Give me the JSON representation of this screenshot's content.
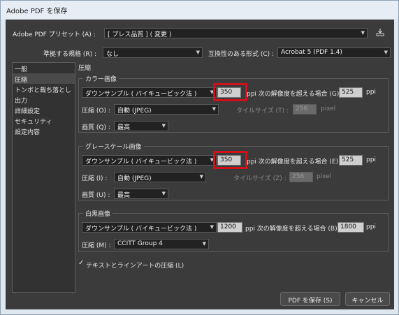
{
  "window": {
    "title": "Adobe PDF を保存"
  },
  "preset": {
    "label": "Adobe PDF プリセット (A) :",
    "value": "[ プレス品質 ] ( 変更 )"
  },
  "standard": {
    "label": "準拠する規格 (R) :",
    "value": "なし"
  },
  "compat": {
    "label": "互換性のある形式 (C) :",
    "value": "Acrobat 5 (PDF 1.4)"
  },
  "nav": {
    "items": [
      "一般",
      "圧縮",
      "トンボと裁ち落とし",
      "出力",
      "詳細設定",
      "セキュリティ",
      "設定内容"
    ]
  },
  "section_title": "圧縮",
  "color": {
    "title": "カラー画像",
    "downsample": "ダウンサンプル ( バイキュービック法 )",
    "ppi_value": "350",
    "threshold_label": "ppi 次の解像度を超える場合 (G)",
    "threshold_value": "525",
    "ppi_unit": "ppi",
    "compression_label": "圧縮 (O) :",
    "compression_value": "自動 (JPEG)",
    "tile_label": "タイルサイズ (T) :",
    "tile_value": "256",
    "tile_unit": "pixel",
    "quality_label": "画質 (Q) :",
    "quality_value": "最高"
  },
  "gray": {
    "title": "グレースケール画像",
    "downsample": "ダウンサンプル ( バイキュービック法 )",
    "ppi_value": "350",
    "threshold_label": "ppi 次の解像度を超える場合 (E)",
    "threshold_value": "525",
    "ppi_unit": "ppi",
    "compression_label": "圧縮 (I) :",
    "compression_value": "自動 (JPEG)",
    "tile_label": "タイルサイズ (Z) :",
    "tile_value": "256",
    "tile_unit": "pixel",
    "quality_label": "画質 (U) :",
    "quality_value": "最高"
  },
  "mono": {
    "title": "白黒画像",
    "downsample": "ダウンサンプル ( バイキュービック法 )",
    "ppi_value": "1200",
    "threshold_label": "ppi 次の解像度を超える場合 (B)",
    "threshold_value": "1800",
    "ppi_unit": "ppi",
    "compression_label": "圧縮 (M) :",
    "compression_value": "CCITT Group 4"
  },
  "text_art": {
    "label": "テキストとラインアートの圧縮 (L)",
    "checkmark": "✓"
  },
  "buttons": {
    "save": "PDF を保存 (S)",
    "cancel": "キャンセル"
  },
  "colors": {
    "highlight": "#d0101b",
    "panel": "#3b3b3b"
  }
}
